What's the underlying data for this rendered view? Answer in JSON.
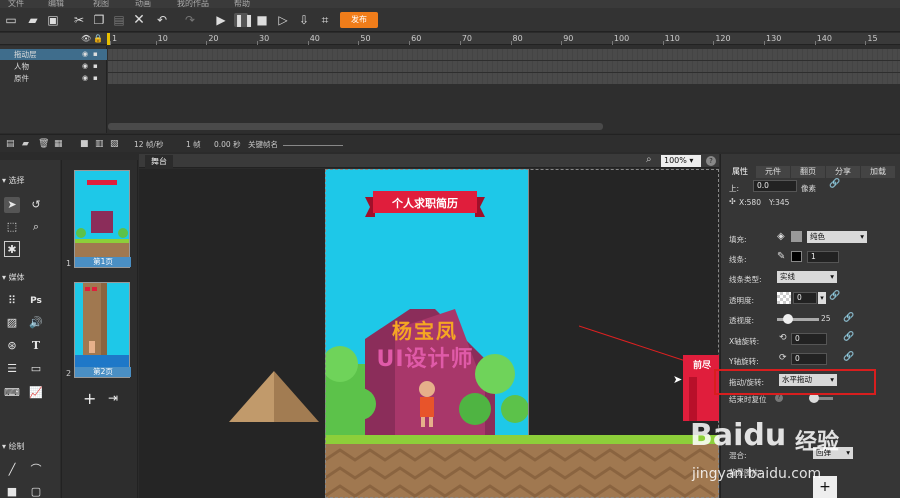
{
  "menu": [
    "文件",
    "编辑",
    "视图",
    "动画",
    "我的作品",
    "帮助"
  ],
  "toolbar": {
    "publish_label": "发布"
  },
  "ruler": {
    "ticks": [
      "1",
      "10",
      "20",
      "30",
      "40",
      "50",
      "60",
      "70",
      "80",
      "90",
      "100",
      "110",
      "120",
      "130",
      "140",
      "15"
    ]
  },
  "layers": [
    {
      "name": "拖动层",
      "selected": true
    },
    {
      "name": "人物",
      "selected": false
    },
    {
      "name": "原件",
      "selected": false
    }
  ],
  "timeline_status": {
    "fps": "12 帧/秒",
    "frame": "1 帧",
    "time": "0.00 秒",
    "keyframe_label": "关键帧名"
  },
  "tools": {
    "select": "选择",
    "media": "媒体",
    "draw": "绘制"
  },
  "pages": [
    {
      "num": "1",
      "label": "第1页"
    },
    {
      "num": "2",
      "label": "第2页"
    }
  ],
  "stage": {
    "tab": "舞台",
    "zoom": "100%",
    "banner": "个人求职简历",
    "title_line1": "杨宝凤",
    "title_line2": "UI设计师",
    "right_object_text": "前尽"
  },
  "panel": {
    "tabs": [
      "属性",
      "元件",
      "翻页",
      "分享",
      "加载"
    ],
    "top_label": "上:",
    "top_value": "0.0",
    "unit": "像素",
    "x": "X:580",
    "y": "Y:345",
    "fill_label": "填充:",
    "fill_value": "纯色",
    "stroke_label": "线条:",
    "stroke_value": "1",
    "stroke_type_label": "线条类型:",
    "stroke_type_value": "实线",
    "opacity_label": "透明度:",
    "opacity_value": "0",
    "blur_label": "透视度:",
    "blur_value": "25",
    "blur_level": 25,
    "xrot_label": "X轴旋转:",
    "xrot_value": "0",
    "yrot_label": "Y轴旋转:",
    "yrot_value": "0",
    "drag_label": "拖动/旋转:",
    "drag_value": "水平拖动",
    "reset_label": "结束时复位",
    "blend_label": "混合:",
    "blend_value": "回弹",
    "bg_label": "背景图片:",
    "add_label": "+"
  },
  "watermark": {
    "brand": "Baidu",
    "product": "经验",
    "url": "jingyan.baidu.com"
  }
}
